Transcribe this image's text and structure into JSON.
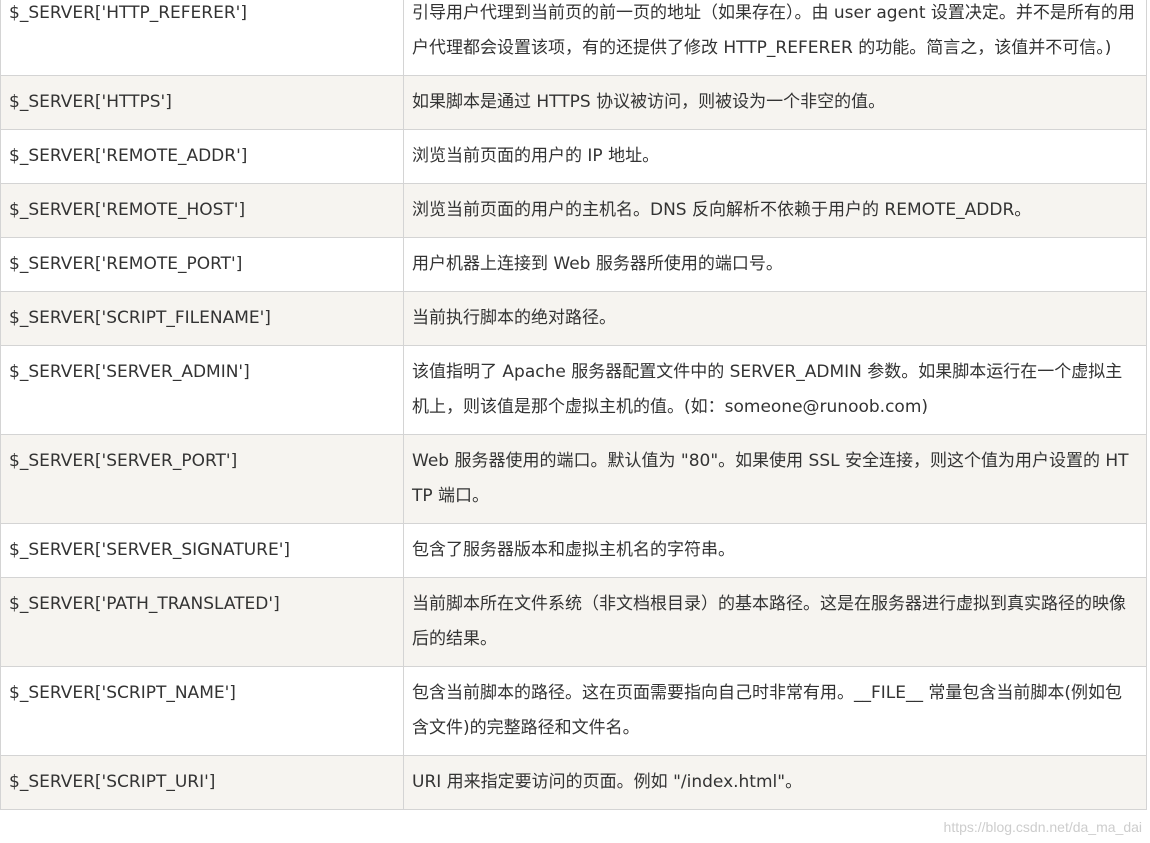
{
  "table": {
    "rows": [
      {
        "name": "$_SERVER['HTTP_REFERER']",
        "desc": "引导用户代理到当前页的前一页的地址（如果存在）。由 user agent 设置决定。并不是所有的用户代理都会设置该项，有的还提供了修改 HTTP_REFERER 的功能。简言之，该值并不可信。)"
      },
      {
        "name": "$_SERVER['HTTPS']",
        "desc": "如果脚本是通过 HTTPS 协议被访问，则被设为一个非空的值。"
      },
      {
        "name": "$_SERVER['REMOTE_ADDR']",
        "desc": "浏览当前页面的用户的 IP 地址。"
      },
      {
        "name": "$_SERVER['REMOTE_HOST']",
        "desc": "浏览当前页面的用户的主机名。DNS 反向解析不依赖于用户的 REMOTE_ADDR。"
      },
      {
        "name": "$_SERVER['REMOTE_PORT']",
        "desc": "用户机器上连接到 Web 服务器所使用的端口号。"
      },
      {
        "name": "$_SERVER['SCRIPT_FILENAME']",
        "desc": "当前执行脚本的绝对路径。"
      },
      {
        "name": "$_SERVER['SERVER_ADMIN']",
        "desc": "该值指明了 Apache 服务器配置文件中的 SERVER_ADMIN 参数。如果脚本运行在一个虚拟主机上，则该值是那个虚拟主机的值。(如：someone@runoob.com)"
      },
      {
        "name": "$_SERVER['SERVER_PORT']",
        "desc": "Web 服务器使用的端口。默认值为 \"80\"。如果使用 SSL 安全连接，则这个值为用户设置的 HTTP 端口。"
      },
      {
        "name": "$_SERVER['SERVER_SIGNATURE']",
        "desc": "包含了服务器版本和虚拟主机名的字符串。"
      },
      {
        "name": "$_SERVER['PATH_TRANSLATED']",
        "desc": "当前脚本所在文件系统（非文档根目录）的基本路径。这是在服务器进行虚拟到真实路径的映像后的结果。"
      },
      {
        "name": "$_SERVER['SCRIPT_NAME']",
        "desc": "包含当前脚本的路径。这在页面需要指向自己时非常有用。__FILE__ 常量包含当前脚本(例如包含文件)的完整路径和文件名。"
      },
      {
        "name": "$_SERVER['SCRIPT_URI']",
        "desc": "URI 用来指定要访问的页面。例如 \"/index.html\"。"
      }
    ]
  },
  "watermark": "https://blog.csdn.net/da_ma_dai"
}
